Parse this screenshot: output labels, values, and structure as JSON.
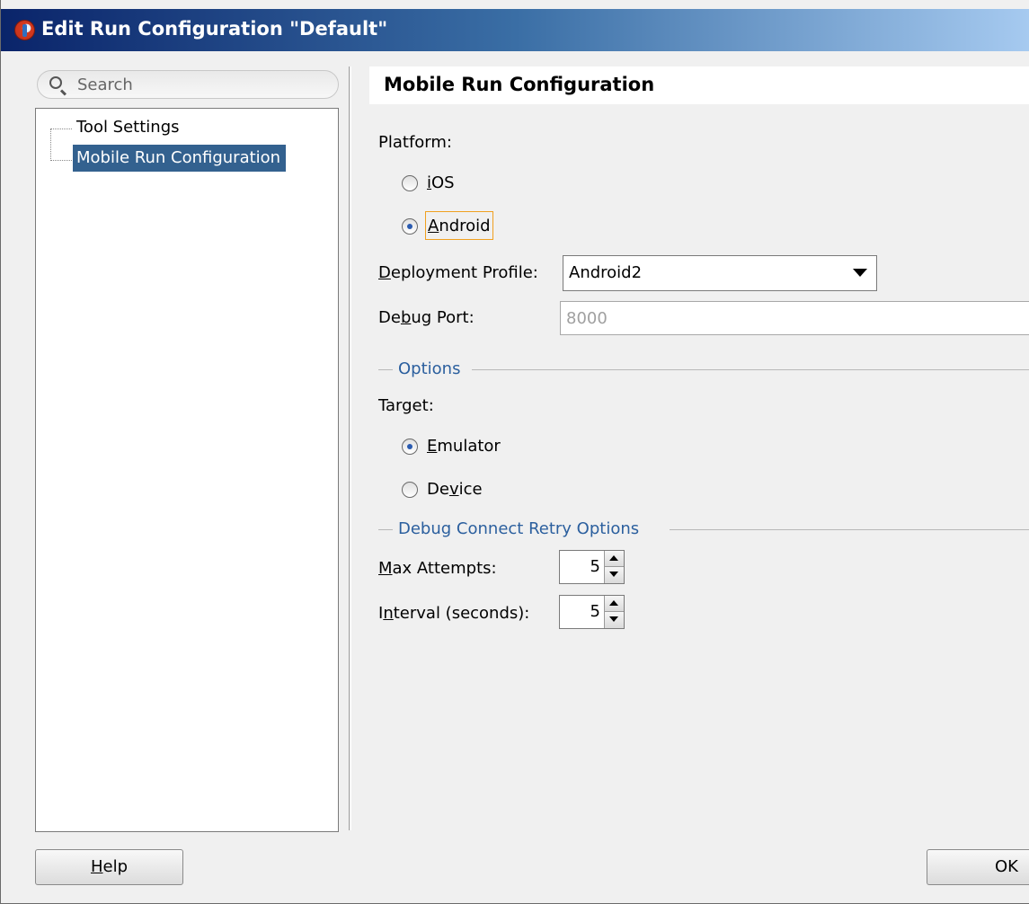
{
  "window": {
    "title": "Edit Run Configuration \"Default\""
  },
  "search": {
    "placeholder": "Search"
  },
  "tree": {
    "items": [
      {
        "label": "Tool Settings",
        "selected": false
      },
      {
        "label": "Mobile Run Configuration",
        "selected": true
      }
    ]
  },
  "panel": {
    "title": "Mobile Run Configuration",
    "platform": {
      "label": "Platform:",
      "options": [
        {
          "pre": "",
          "mnemonic": "i",
          "post": "OS",
          "checked": false
        },
        {
          "pre": "",
          "mnemonic": "A",
          "post": "ndroid",
          "checked": true
        }
      ]
    },
    "deployment_profile": {
      "label_mnemonic": "D",
      "label_rest": "eployment Profile:",
      "value": "Android2"
    },
    "debug_port": {
      "label_pre": "De",
      "label_mnemonic": "b",
      "label_post": "ug Port:",
      "value": "8000"
    },
    "options_group": {
      "title": "Options"
    },
    "target": {
      "label": "Target:",
      "options": [
        {
          "pre": "",
          "mnemonic": "E",
          "post": "mulator",
          "checked": true
        },
        {
          "pre": "De",
          "mnemonic": "v",
          "post": "ice",
          "checked": false
        }
      ]
    },
    "retry_group": {
      "title": "Debug Connect Retry Options"
    },
    "max_attempts": {
      "label_mnemonic": "M",
      "label_rest": "ax Attempts:",
      "value": "5"
    },
    "interval": {
      "label_pre": "I",
      "label_mnemonic": "n",
      "label_post": "terval (seconds):",
      "value": "5"
    }
  },
  "buttons": {
    "help": {
      "mnemonic": "H",
      "rest": "elp"
    },
    "ok": "OK"
  },
  "colors": {
    "selection": "#33618f",
    "group_title": "#2b5f9e",
    "focus_border": "#f0a020"
  }
}
